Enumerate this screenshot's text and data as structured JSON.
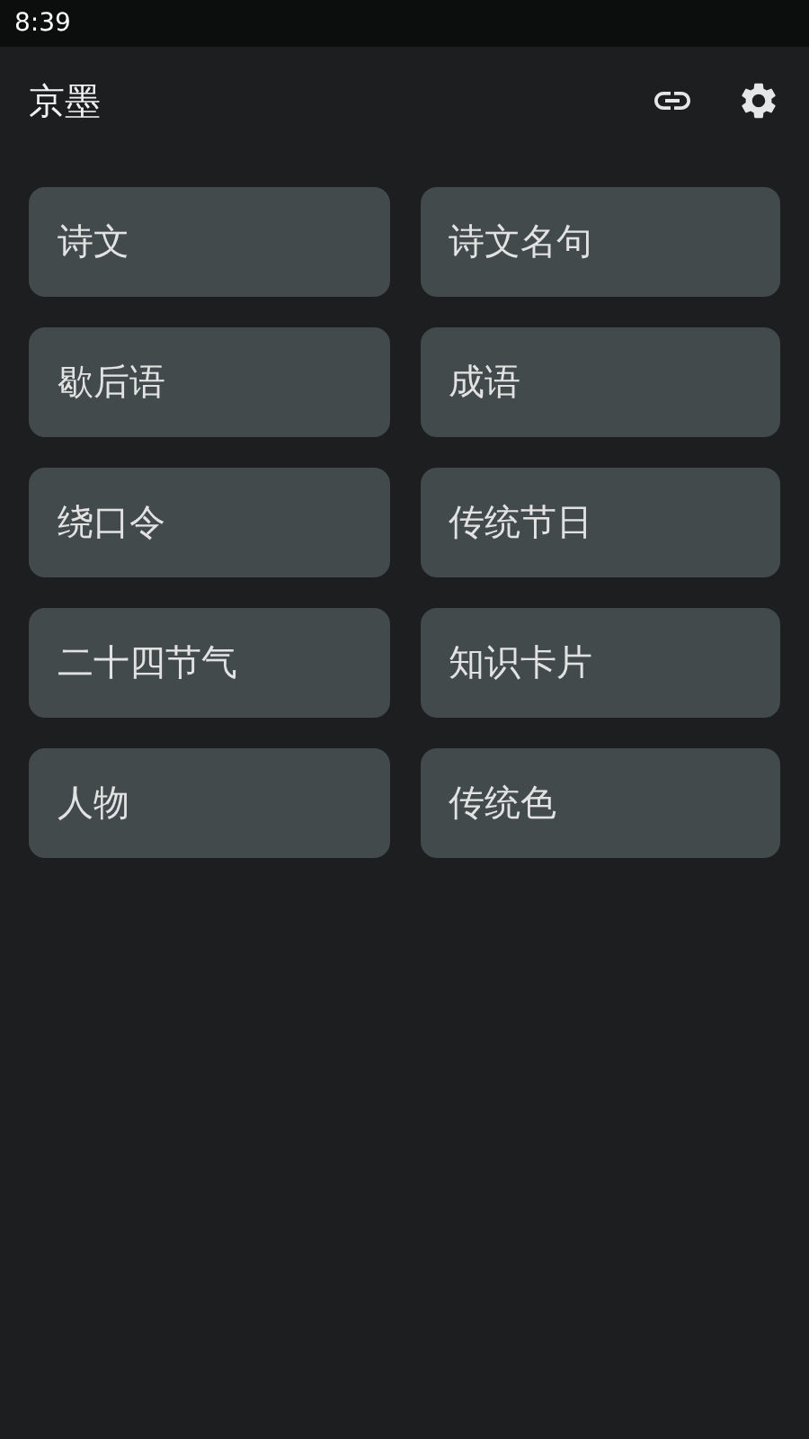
{
  "status_bar": {
    "time": "8:39"
  },
  "app_bar": {
    "title": "京墨"
  },
  "items": [
    {
      "label": "诗文"
    },
    {
      "label": "诗文名句"
    },
    {
      "label": "歇后语"
    },
    {
      "label": "成语"
    },
    {
      "label": "绕口令"
    },
    {
      "label": "传统节日"
    },
    {
      "label": "二十四节气"
    },
    {
      "label": "知识卡片"
    },
    {
      "label": "人物"
    },
    {
      "label": "传统色"
    }
  ]
}
